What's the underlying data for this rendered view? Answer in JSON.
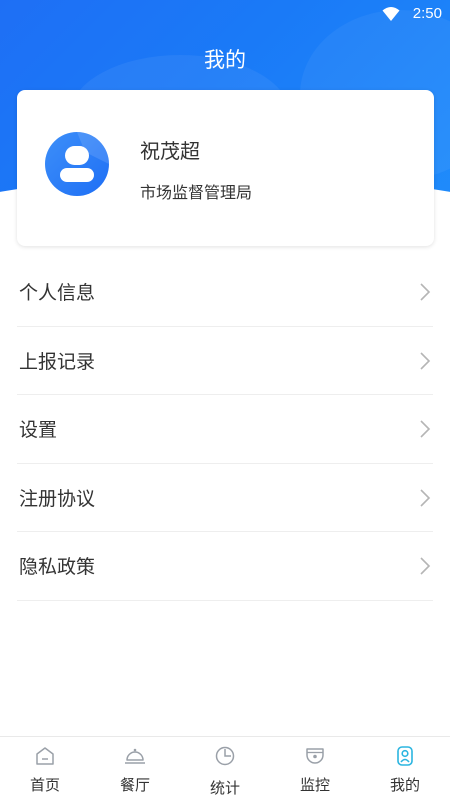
{
  "status_bar": {
    "time": "2:50"
  },
  "header": {
    "title": "我的"
  },
  "profile": {
    "name": "祝茂超",
    "organization": "市场监督管理局"
  },
  "menu": [
    {
      "label": "个人信息"
    },
    {
      "label": "上报记录"
    },
    {
      "label": "设置"
    },
    {
      "label": "注册协议"
    },
    {
      "label": "隐私政策"
    }
  ],
  "tabbar": [
    {
      "label": "首页",
      "icon": "home-icon"
    },
    {
      "label": "餐厅",
      "icon": "cloche-icon"
    },
    {
      "label": "统计",
      "icon": "pie-chart-icon"
    },
    {
      "label": "监控",
      "icon": "camera-icon"
    },
    {
      "label": "我的",
      "icon": "user-icon",
      "active": true
    }
  ],
  "colors": {
    "brand": "#1e6ff5",
    "active_icon": "#2bb5e0"
  }
}
